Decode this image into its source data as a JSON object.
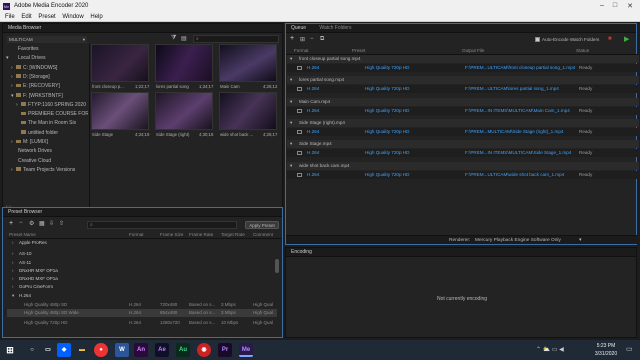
{
  "titlebar": {
    "title": "Adobe Media Encoder 2020",
    "min": "–",
    "max": "□",
    "close": "✕"
  },
  "menu": [
    "File",
    "Edit",
    "Preset",
    "Window",
    "Help"
  ],
  "media_browser": {
    "tab": "Media Browser",
    "drive": "MULTICAM",
    "tree": [
      {
        "label": "Favorites",
        "indent": 0,
        "arrow": ""
      },
      {
        "label": "Local Drives",
        "indent": 0,
        "arrow": "▾"
      },
      {
        "label": "C: [WINDOWS]",
        "indent": 1,
        "arrow": "›"
      },
      {
        "label": "D: [Storage]",
        "indent": 1,
        "arrow": "›"
      },
      {
        "label": "E: [RECOVERY]",
        "indent": 1,
        "arrow": "›"
      },
      {
        "label": "F: [WRKSTBNTF]",
        "indent": 1,
        "arrow": "▾"
      },
      {
        "label": "FTYP:1160 SPRING 2020",
        "indent": 2,
        "arrow": "›"
      },
      {
        "label": "PREMIERE COURSE FOR",
        "indent": 2,
        "arrow": ""
      },
      {
        "label": "The Man in Room Six",
        "indent": 2,
        "arrow": ""
      },
      {
        "label": "untitled folder",
        "indent": 2,
        "arrow": ""
      },
      {
        "label": "M: [LUMIX]",
        "indent": 1,
        "arrow": "›"
      },
      {
        "label": "Network Drives",
        "indent": 0,
        "arrow": ""
      },
      {
        "label": "Creative Cloud",
        "indent": 0,
        "arrow": ""
      },
      {
        "label": "Team Projects Versions",
        "indent": 1,
        "arrow": "›"
      }
    ],
    "clips": [
      {
        "name": "front closeup p...",
        "dur": "1;22;17"
      },
      {
        "name": "lores partial song",
        "dur": "1;34;17"
      },
      {
        "name": "Main Cam",
        "dur": "4;25;12"
      },
      {
        "name": "Side Stage",
        "dur": "4;34;19"
      },
      {
        "name": "Side Stage (right)",
        "dur": "4;30;18"
      },
      {
        "name": "wide shot back ...",
        "dur": "4;25;17"
      }
    ]
  },
  "preset_browser": {
    "tab": "Preset Browser",
    "apply": "Apply Preset",
    "cols": [
      "Preset Name",
      "Format",
      "Frame Size",
      "Frame Rate",
      "Target Rate",
      "Comment"
    ],
    "rows": [
      {
        "name": "Apple ProRes",
        "indent": 1,
        "arrow": "›",
        "format": "",
        "size": "",
        "rate": "",
        "target": "",
        "comment": ""
      },
      {
        "name": "AS-10",
        "indent": 1,
        "arrow": "›",
        "format": "",
        "size": "",
        "rate": "",
        "target": "",
        "comment": ""
      },
      {
        "name": "AS-11",
        "indent": 1,
        "arrow": "›",
        "format": "",
        "size": "",
        "rate": "",
        "target": "",
        "comment": ""
      },
      {
        "name": "DNxHR MXF OP1a",
        "indent": 1,
        "arrow": "›",
        "format": "",
        "size": "",
        "rate": "",
        "target": "",
        "comment": ""
      },
      {
        "name": "DNxHD MXF OP1a",
        "indent": 1,
        "arrow": "›",
        "format": "",
        "size": "",
        "rate": "",
        "target": "",
        "comment": ""
      },
      {
        "name": "GoPro CineForm",
        "indent": 1,
        "arrow": "›",
        "format": "",
        "size": "",
        "rate": "",
        "target": "",
        "comment": ""
      },
      {
        "name": "H.264",
        "indent": 1,
        "arrow": "▾",
        "format": "",
        "size": "",
        "rate": "",
        "target": "",
        "comment": ""
      },
      {
        "name": "High Quality 480p SD",
        "indent": 2,
        "arrow": "",
        "format": "H.264",
        "size": "720x480",
        "rate": "Based on s...",
        "target": "3 Mbps",
        "comment": "High Qual"
      },
      {
        "name": "High Quality 480p SD Wide",
        "indent": 2,
        "arrow": "",
        "format": "H.264",
        "size": "854x480",
        "rate": "Based on s...",
        "target": "3 Mbps",
        "comment": "High Qual",
        "selected": true
      },
      {
        "name": "High Quality 720p HD",
        "indent": 2,
        "arrow": "",
        "format": "H.264",
        "size": "1280x720",
        "rate": "Based on s...",
        "target": "10 Mbps",
        "comment": "High Qual"
      }
    ]
  },
  "queue": {
    "tabs": [
      "Queue",
      "Watch Folders"
    ],
    "auto_encode": "Auto-Encode Watch Folders",
    "cols": [
      "Format",
      "Preset",
      "Output File",
      "Status"
    ],
    "items": [
      {
        "source": "front closeup partial song.mp4",
        "format": "H.264",
        "preset": "High Quality 720p HD",
        "output": "F:\\PREM...ULTICAM\\front closeup partial song_1.mp4",
        "status": "Ready"
      },
      {
        "source": "lores partial song.mp4",
        "format": "H.264",
        "preset": "High Quality 720p HD",
        "output": "F:\\PREM...ULTICAM\\lores partial song_1.mp4",
        "status": "Ready"
      },
      {
        "source": "Main Cam.mp4",
        "format": "H.264",
        "preset": "High Quality 720p HD",
        "output": "F:\\PREM...IN ITEMS\\MULTICAM\\Main Cam_1.mp4",
        "status": "Ready"
      },
      {
        "source": "Side Stage (right).mp4",
        "format": "H.264",
        "preset": "High Quality 720p HD",
        "output": "F:\\PREM...MULTICAM\\Side Stage (right)_1.mp4",
        "status": "Ready"
      },
      {
        "source": "Side Stage.mp4",
        "format": "H.264",
        "preset": "High Quality 720p HD",
        "output": "F:\\PREM...IN ITEMS\\MULTICAM\\Side Stage_1.mp4",
        "status": "Ready"
      },
      {
        "source": "wide shot back cam.mp4",
        "format": "H.264",
        "preset": "High Quality 720p HD",
        "output": "F:\\PREM...ULTICAM\\wide shot back cam_1.mp4",
        "status": "Ready"
      }
    ],
    "renderer_label": "Renderer:",
    "renderer_value": "Mercury Playback Engine Software Only"
  },
  "encoding": {
    "tab": "Encoding",
    "status": "Not currently encoding"
  },
  "taskbar": {
    "time": "5:23 PM",
    "date": "3/31/2020"
  },
  "colors": {
    "accent": "#3ea3ff",
    "panel": "#232323",
    "bg": "#1d1d1d",
    "go": "#3cb043",
    "stop": "#c0392b"
  }
}
